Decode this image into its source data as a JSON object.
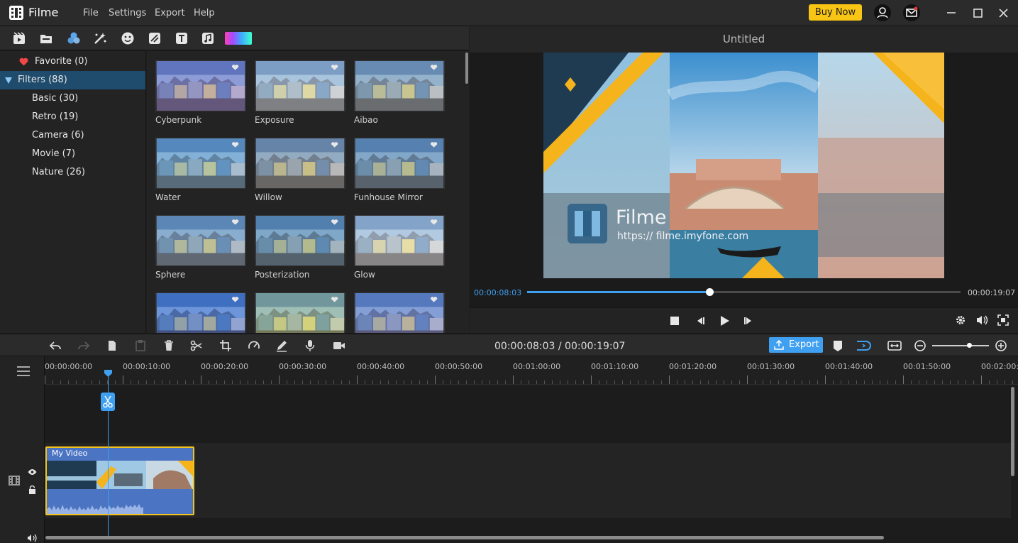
{
  "app": {
    "name": "Filme",
    "menu": [
      "File",
      "Settings",
      "Export",
      "Help"
    ],
    "buy_now": "Buy Now"
  },
  "categories": {
    "favorite": "Favorite (0)",
    "filters": "Filters (88)",
    "sub": [
      "Basic (30)",
      "Retro (19)",
      "Camera (6)",
      "Movie (7)",
      "Nature (26)"
    ]
  },
  "filters": [
    {
      "label": "Cyberpunk",
      "tint": "#8a6fd6"
    },
    {
      "label": "Exposure",
      "tint": "#d9e6ef"
    },
    {
      "label": "Aibao",
      "tint": "#9fb0b8"
    },
    {
      "label": "Water",
      "tint": "#6aa8d8"
    },
    {
      "label": "Willow",
      "tint": "#9a9a9a"
    },
    {
      "label": "Funhouse Mirror",
      "tint": "#6b8fb0"
    },
    {
      "label": "Sphere",
      "tint": "#7ea0c0"
    },
    {
      "label": "Posterization",
      "tint": "#5f8fb0"
    },
    {
      "label": "Glow",
      "tint": "#f2f4f5"
    },
    {
      "label": "",
      "tint": "#2b5fe0"
    },
    {
      "label": "",
      "tint": "#b9d27a"
    },
    {
      "label": "",
      "tint": "#6d78d8"
    }
  ],
  "preview": {
    "title": "Untitled",
    "watermark_name": "Filme",
    "watermark_url": "https:// filme.imyfone.com",
    "current_time": "00:00:08:03",
    "total_time": "00:00:19:07",
    "progress": 0.42
  },
  "editor": {
    "time_current": "00:00:08:03",
    "time_sep": "/",
    "time_total": "00:00:19:07",
    "export_label": "Export"
  },
  "timeline": {
    "ruler": [
      "00:00:00:00",
      "00:00:10:00",
      "00:00:20:00",
      "00:00:30:00",
      "00:00:40:00",
      "00:00:50:00",
      "00:01:00:00",
      "00:01:10:00",
      "00:01:20:00",
      "00:01:30:00",
      "00:01:40:00",
      "00:01:50:00",
      "00:02:00:00"
    ],
    "clip_label": "My Video"
  },
  "colors": {
    "accent": "#3f9ff0",
    "buy_now": "#f8c514",
    "clip_border": "#f3c21b",
    "clip_fill": "#4b74c2"
  }
}
